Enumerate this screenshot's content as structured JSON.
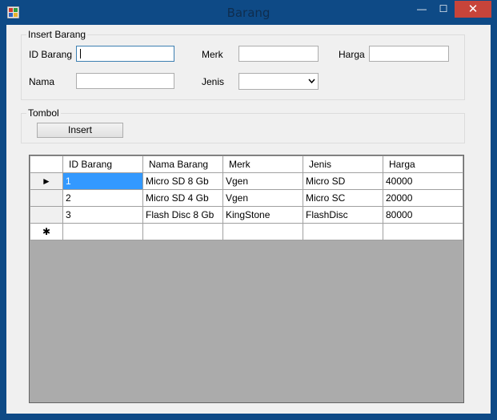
{
  "window": {
    "title": "Barang",
    "minimize_glyph": "—",
    "maximize_glyph": "☐",
    "close_glyph": "✕"
  },
  "insert_group": {
    "legend": "Insert Barang",
    "id_label": "ID Barang",
    "nama_label": "Nama",
    "merk_label": "Merk",
    "jenis_label": "Jenis",
    "harga_label": "Harga",
    "id_value": "",
    "nama_value": "",
    "merk_value": "",
    "jenis_value": "",
    "harga_value": ""
  },
  "tombol_group": {
    "legend": "Tombol",
    "insert_label": "Insert"
  },
  "grid": {
    "columns": [
      "ID Barang",
      "Nama Barang",
      "Merk",
      "Jenis",
      "Harga"
    ],
    "rows": [
      {
        "marker": "►",
        "cells": [
          "1",
          "Micro SD 8 Gb",
          "Vgen",
          "Micro SD",
          "40000"
        ]
      },
      {
        "marker": "",
        "cells": [
          "2",
          "Micro SD 4 Gb",
          "Vgen",
          "Micro SC",
          "20000"
        ]
      },
      {
        "marker": "",
        "cells": [
          "3",
          "Flash Disc 8 Gb",
          "KingStone",
          "FlashDisc",
          "80000"
        ]
      }
    ],
    "new_row_marker": "✱"
  },
  "colors": {
    "titlebar": "#0e4a86",
    "close": "#c7443a",
    "selection": "#3399ff"
  },
  "icons": {
    "app": "app-icon",
    "dropdown": "chevron-down-icon"
  }
}
